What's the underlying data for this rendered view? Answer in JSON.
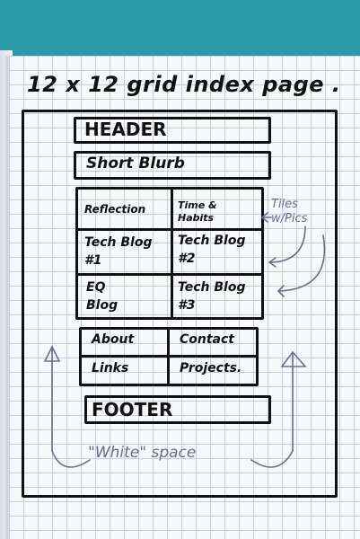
{
  "title": "12 x 12 grid index page .",
  "sketch": {
    "header": "HEADER",
    "blurb": "Short Blurb",
    "tiles": [
      {
        "label": "Reflection"
      },
      {
        "label": "Time & Habits"
      },
      {
        "label": "Tech Blog #1"
      },
      {
        "label": "Tech Blog #2"
      },
      {
        "label": "EQ Blog"
      },
      {
        "label": "Tech Blog #3"
      }
    ],
    "links": [
      "About",
      "Contact",
      "Links",
      "Projects."
    ],
    "footer": "FOOTER",
    "annotation_tiles": "Tiles w/Pics",
    "annotation_space": "\"White\" space"
  },
  "colors": {
    "background": "#2a9aa6",
    "paper": "#f7f8fa",
    "grid": "#c9cdd6",
    "ink": "#111111",
    "pencil": "#6b6aa0"
  }
}
